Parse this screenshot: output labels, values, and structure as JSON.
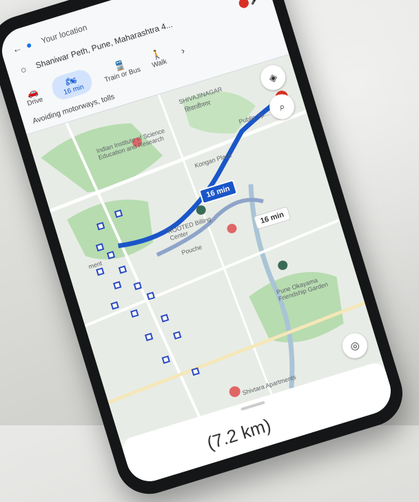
{
  "header": {
    "origin_label": "Your location",
    "destination": "Shaniwar Peth, Pune, Maharashtra 4...",
    "avoid_text": "Avoiding motorways, tolls"
  },
  "modes": [
    {
      "icon": "car-icon",
      "label": "Drive"
    },
    {
      "icon": "motorbike-icon",
      "label": "16 min"
    },
    {
      "icon": "train-icon",
      "label": "Train or Bus"
    },
    {
      "icon": "walk-icon",
      "label": "Walk"
    }
  ],
  "map": {
    "labels": {
      "area_top": "SHIVAJINAGAR",
      "area_top2": "शिवाजीनगर",
      "institute": "Indian Institute of Science Education and Research",
      "public_library": "Public Sp...",
      "ko_place": "Kongan Place",
      "hotel": "ROOTED Billing Center",
      "pouche": "Pouche",
      "garden": "Pune Okayama Friendship Garden",
      "ment": "ment",
      "apartment": "Shivtara Apartments"
    },
    "time_main": "16 min",
    "time_alt": "16 min"
  },
  "sheet": {
    "distance_text": "(7.2 km)"
  },
  "colors": {
    "route_primary": "#1a56c9",
    "route_alt": "#8ea4c9",
    "pin_red": "#d93025",
    "park_green": "#b7dcb0",
    "stop_blue": "#2948c4"
  }
}
